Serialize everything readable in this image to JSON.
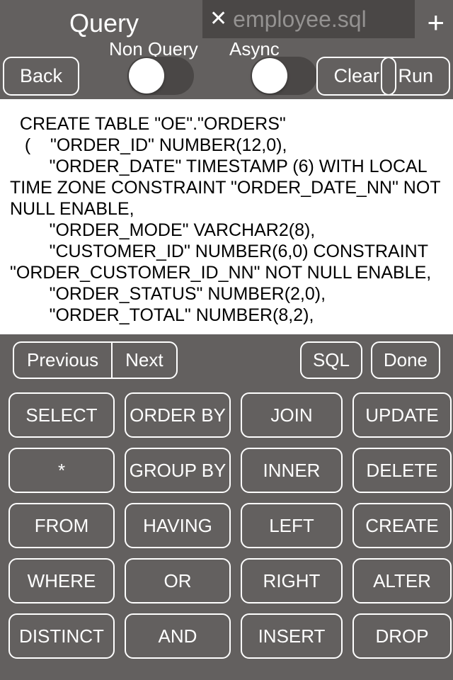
{
  "header": {
    "title": "Query",
    "tab_close": "✕",
    "tab_name": "employee.sql",
    "plus": "+"
  },
  "labels": {
    "non_query": "Non Query",
    "async": "Async"
  },
  "toolbar": {
    "back": "Back",
    "clear": "Clear",
    "run": "Run"
  },
  "editor": {
    "content": "  CREATE TABLE \"OE\".\"ORDERS\"\n   (    \"ORDER_ID\" NUMBER(12,0),\n        \"ORDER_DATE\" TIMESTAMP (6) WITH LOCAL TIME ZONE CONSTRAINT \"ORDER_DATE_NN\" NOT NULL ENABLE,\n        \"ORDER_MODE\" VARCHAR2(8),\n        \"CUSTOMER_ID\" NUMBER(6,0) CONSTRAINT \"ORDER_CUSTOMER_ID_NN\" NOT NULL ENABLE,\n        \"ORDER_STATUS\" NUMBER(2,0),\n        \"ORDER_TOTAL\" NUMBER(8,2),"
  },
  "nav": {
    "previous": "Previous",
    "next": "Next",
    "sql": "SQL",
    "done": "Done"
  },
  "keyboard": {
    "rows": [
      [
        "SELECT",
        "ORDER BY",
        "JOIN",
        "UPDATE"
      ],
      [
        "*",
        "GROUP BY",
        "INNER",
        "DELETE"
      ],
      [
        "FROM",
        "HAVING",
        "LEFT",
        "CREATE"
      ],
      [
        "WHERE",
        "OR",
        "RIGHT",
        "ALTER"
      ],
      [
        "DISTINCT",
        "AND",
        "INSERT",
        "DROP"
      ]
    ]
  }
}
